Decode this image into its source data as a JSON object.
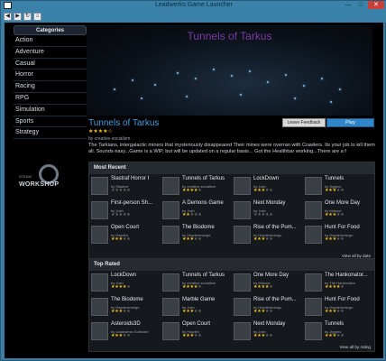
{
  "window": {
    "title": "Leadwerks Game Launcher",
    "min": "—",
    "max": "□",
    "close": "✕"
  },
  "toolbar": {
    "back": "◀",
    "forward": "▶",
    "refresh": "↻",
    "home": "⌂"
  },
  "sidebar": {
    "header": "Categories",
    "items": [
      {
        "label": "Action"
      },
      {
        "label": "Adventure"
      },
      {
        "label": "Casual"
      },
      {
        "label": "Horror"
      },
      {
        "label": "Racing"
      },
      {
        "label": "RPG"
      },
      {
        "label": "Simulation"
      },
      {
        "label": "Sports"
      },
      {
        "label": "Strategy"
      }
    ]
  },
  "workshop": {
    "top": "STEAM",
    "label": "WORKSHOP"
  },
  "featured": {
    "banner_title": "Tunnels of Tarkus",
    "title": "Tunnels of Tarkus",
    "stars": "★★★★☆",
    "by": "by creative-socialism",
    "description": "The Tarkians, intergalactic miners that mysteriously disappeared Their mines were overran with Crawlers. Its your job to kill them all. Sounds easy...Game is a WIP, but will be updated on a regular basis... Got the Healthbar working...There are a f",
    "feedback_label": "Leave Feedback",
    "play_label": "Play"
  },
  "most_recent": {
    "header": "Most Recent",
    "view_all": "View all by date",
    "games": [
      {
        "title": "Slastraf Horror I",
        "by": "by Slastraf",
        "rating": 0
      },
      {
        "title": "Tunnels of Tarkus",
        "by": "by creative-socialism",
        "rating": 4
      },
      {
        "title": "LockDown",
        "by": "by Josh",
        "rating": 3
      },
      {
        "title": "Tunnels",
        "by": "by Jiggers",
        "rating": 3
      },
      {
        "title": "First-person Sh...",
        "by": "by Josh",
        "rating": 0
      },
      {
        "title": "A Demons Game",
        "by": "by Josh",
        "rating": 2
      },
      {
        "title": "Next Monday",
        "by": "by Josh",
        "rating": 0
      },
      {
        "title": "One More Day",
        "by": "by Mdsout",
        "rating": 3
      },
      {
        "title": "Open Court",
        "by": "by Hayden",
        "rating": 3
      },
      {
        "title": "The Biodome",
        "by": "by Haydenmango",
        "rating": 3
      },
      {
        "title": "Rise of the Pum...",
        "by": "by Haydenmango",
        "rating": 3
      },
      {
        "title": "Hunt For Food",
        "by": "by Haydenmango",
        "rating": 3
      }
    ]
  },
  "top_rated": {
    "header": "Top Rated",
    "view_all": "View all by rating",
    "games": [
      {
        "title": "LockDown",
        "by": "by Josh",
        "rating": 4
      },
      {
        "title": "Tunnels of Tarkus",
        "by": "by creative-socialism",
        "rating": 4
      },
      {
        "title": "One More Day",
        "by": "by Mdsout",
        "rating": 4
      },
      {
        "title": "The Hankonator...",
        "by": "by The Hankonator",
        "rating": 4
      },
      {
        "title": "The Biodome",
        "by": "by Haydenmango",
        "rating": 3
      },
      {
        "title": "Marble Game",
        "by": "by Josh",
        "rating": 3
      },
      {
        "title": "Rise of the Pum...",
        "by": "by Haydenmango",
        "rating": 3
      },
      {
        "title": "Hunt For Food",
        "by": "by Haydenmango",
        "rating": 3
      },
      {
        "title": "Asteroids3D",
        "by": "by Leadwerks Software",
        "rating": 3
      },
      {
        "title": "Open Court",
        "by": "by Hayden",
        "rating": 3
      },
      {
        "title": "Next Monday",
        "by": "by Josh",
        "rating": 3
      },
      {
        "title": "Tunnels",
        "by": "by Jiggers",
        "rating": 3
      }
    ]
  },
  "colors": {
    "accent": "#3f9fe0",
    "star": "#f0c020",
    "play": "#2f86c9"
  }
}
